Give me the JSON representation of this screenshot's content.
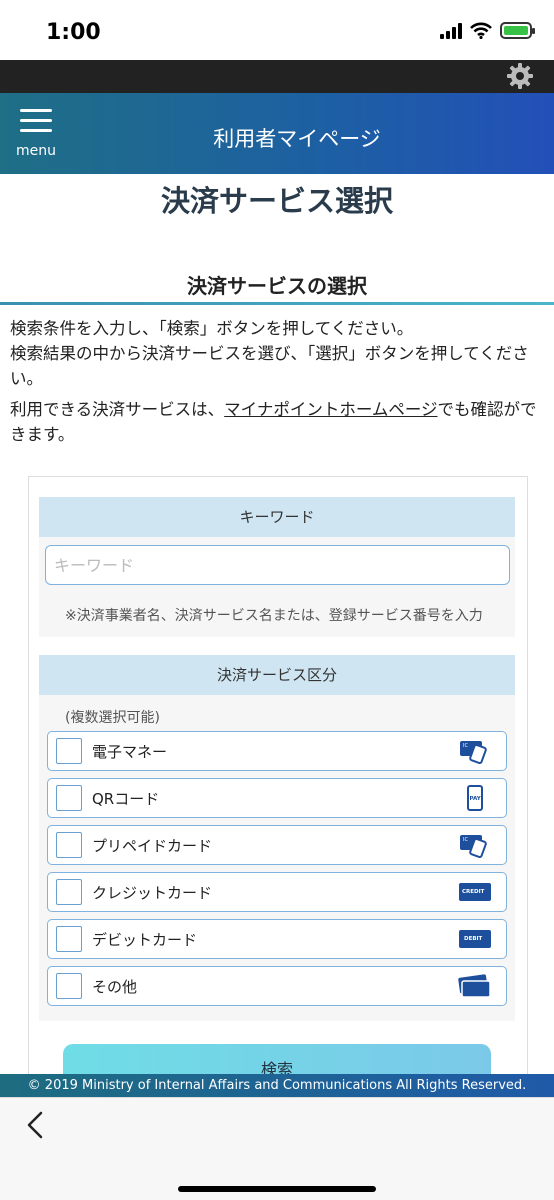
{
  "status": {
    "time": "1:00"
  },
  "header": {
    "menu_label": "menu",
    "title": "利用者マイページ"
  },
  "page_title": "決済サービス選択",
  "section_title": "決済サービスの選択",
  "intro": {
    "line1": "検索条件を入力し、「検索」ボタンを押してください。",
    "line2": "検索結果の中から決済サービスを選び、「選択」ボタンを押してください。",
    "line3_before": "利用できる決済サービスは、",
    "line3_link": "マイナポイントホームページ",
    "line3_after": "でも確認ができます。"
  },
  "keyword": {
    "header": "キーワード",
    "placeholder": "キーワード",
    "value": "",
    "note": "※決済事業者名、決済サービス名または、登録サービス番号を入力"
  },
  "service_type": {
    "header": "決済サービス区分",
    "multi_note": "(複数選択可能)",
    "options": [
      {
        "label": "電子マネー",
        "icon": "ic-card-icon",
        "checked": false
      },
      {
        "label": "QRコード",
        "icon": "pay-phone-icon",
        "checked": false
      },
      {
        "label": "プリペイドカード",
        "icon": "ic-card-icon",
        "checked": false
      },
      {
        "label": "クレジットカード",
        "icon": "credit-card-icon",
        "checked": false
      },
      {
        "label": "デビットカード",
        "icon": "debit-card-icon",
        "checked": false
      },
      {
        "label": "その他",
        "icon": "cards-icon",
        "checked": false
      }
    ]
  },
  "search_button": "検索",
  "footer": "© 2019 Ministry of Internal Affairs and Communications All Rights Reserved.",
  "colors": {
    "accent": "#1d5fa4",
    "panel_head": "#cfe5f2",
    "border": "#7fb2de"
  }
}
